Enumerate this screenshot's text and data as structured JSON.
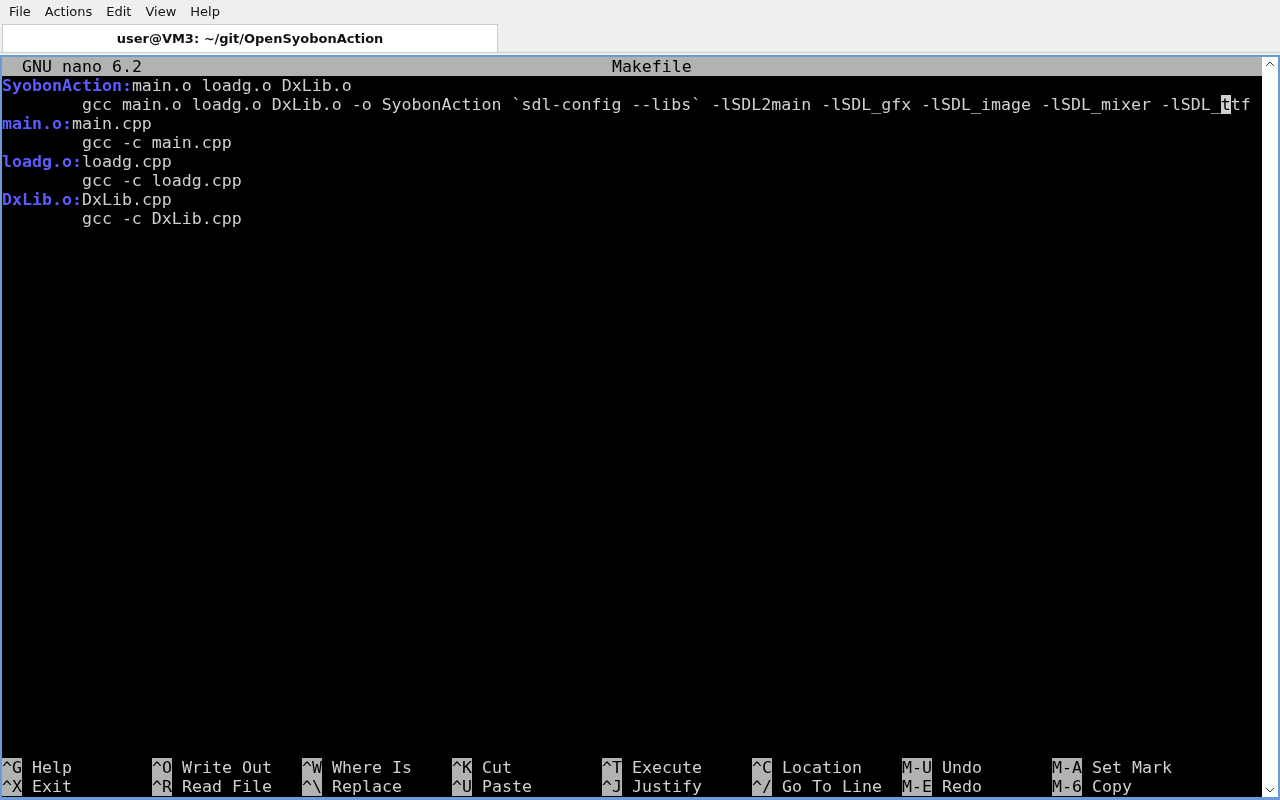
{
  "menu": [
    "File",
    "Actions",
    "Edit",
    "View",
    "Help"
  ],
  "tabs": [
    {
      "label": "user@VM3: ~/git/OpenSyobonAction",
      "selected": true
    }
  ],
  "nano": {
    "version": "GNU nano 6.2",
    "filename": "Makefile"
  },
  "lines": [
    [
      {
        "kind": "target",
        "text": "SyobonAction:"
      },
      {
        "kind": "plain",
        "text": "main.o loadg.o DxLib.o"
      }
    ],
    [
      {
        "kind": "plain",
        "text": "        gcc main.o loadg.o DxLib.o -o SyobonAction `sdl-config --libs` -lSDL2main -lSDL_gfx -lSDL_image -lSDL_mixer -lSDL_"
      },
      {
        "kind": "cursor",
        "text": "t"
      },
      {
        "kind": "plain",
        "text": "tf"
      }
    ],
    [
      {
        "kind": "target",
        "text": "main.o:"
      },
      {
        "kind": "plain",
        "text": "main.cpp"
      }
    ],
    [
      {
        "kind": "plain",
        "text": "        gcc -c main.cpp"
      }
    ],
    [
      {
        "kind": "target",
        "text": "loadg.o:"
      },
      {
        "kind": "plain",
        "text": "loadg.cpp"
      }
    ],
    [
      {
        "kind": "plain",
        "text": "        gcc -c loadg.cpp"
      }
    ],
    [
      {
        "kind": "target",
        "text": "DxLib.o:"
      },
      {
        "kind": "plain",
        "text": "DxLib.cpp"
      }
    ],
    [
      {
        "kind": "plain",
        "text": "        gcc -c DxLib.cpp"
      }
    ]
  ],
  "shortcuts": [
    [
      {
        "key": "^G",
        "label": "Help"
      },
      {
        "key": "^O",
        "label": "Write Out"
      },
      {
        "key": "^W",
        "label": "Where Is"
      },
      {
        "key": "^K",
        "label": "Cut"
      },
      {
        "key": "^T",
        "label": "Execute"
      },
      {
        "key": "^C",
        "label": "Location"
      },
      {
        "key": "M-U",
        "label": "Undo"
      },
      {
        "key": "M-A",
        "label": "Set Mark"
      }
    ],
    [
      {
        "key": "^X",
        "label": "Exit"
      },
      {
        "key": "^R",
        "label": "Read File"
      },
      {
        "key": "^\\",
        "label": "Replace"
      },
      {
        "key": "^U",
        "label": "Paste"
      },
      {
        "key": "^J",
        "label": "Justify"
      },
      {
        "key": "^/",
        "label": "Go To Line"
      },
      {
        "key": "M-E",
        "label": "Redo"
      },
      {
        "key": "M-6",
        "label": "Copy"
      }
    ]
  ]
}
